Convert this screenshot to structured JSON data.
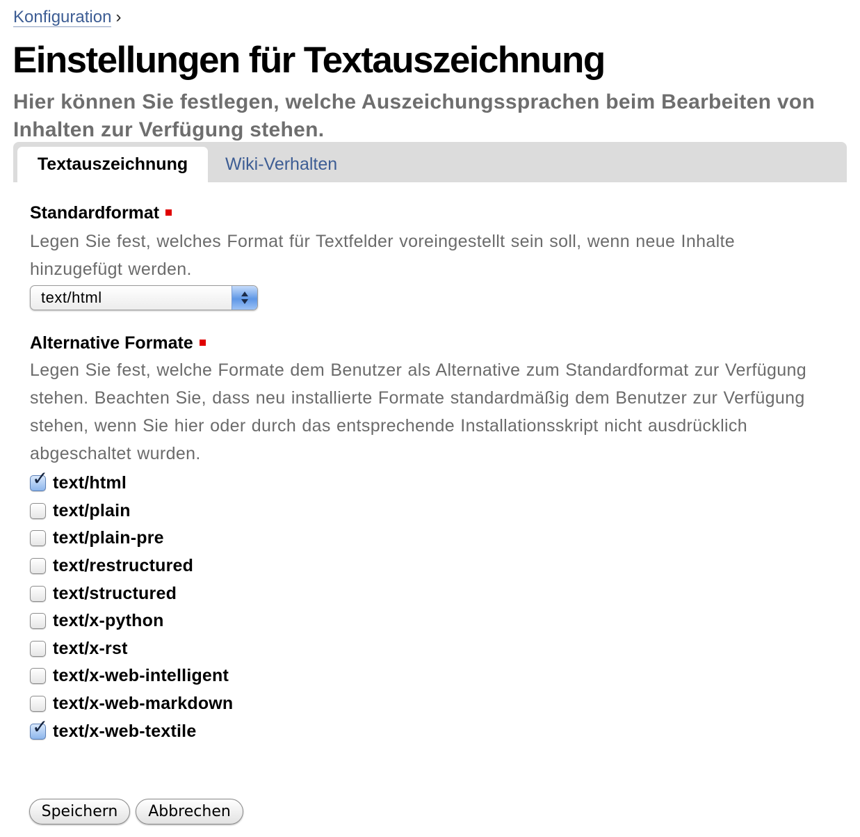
{
  "breadcrumb": {
    "link_label": "Konfiguration",
    "separator": "›"
  },
  "page": {
    "title": "Einstellungen für Textauszeichnung",
    "description": "Hier können Sie festlegen, welche Auszeichungssprachen beim Bearbeiten von Inhalten zur Verfügung stehen."
  },
  "tabs": [
    {
      "label": "Textauszeichnung",
      "active": true
    },
    {
      "label": "Wiki-Verhalten",
      "active": false
    }
  ],
  "default_format": {
    "label": "Standardformat",
    "help": "Legen Sie fest, welches Format für Textfelder voreingestellt sein soll, wenn neue Inhalte hinzugefügt werden.",
    "selected_value": "text/html"
  },
  "alternative_formats": {
    "label": "Alternative Formate",
    "help": "Legen Sie fest, welche Formate dem Benutzer als Alternative zum Standardformat zur Verfügung stehen. Beachten Sie, dass neu installierte Formate standardmäßig dem Benutzer zur Verfügung stehen, wenn Sie hier oder durch das entsprechende Installationsskript nicht ausdrücklich abgeschaltet wurden.",
    "options": [
      {
        "label": "text/html",
        "checked": true
      },
      {
        "label": "text/plain",
        "checked": false
      },
      {
        "label": "text/plain-pre",
        "checked": false
      },
      {
        "label": "text/restructured",
        "checked": false
      },
      {
        "label": "text/structured",
        "checked": false
      },
      {
        "label": "text/x-python",
        "checked": false
      },
      {
        "label": "text/x-rst",
        "checked": false
      },
      {
        "label": "text/x-web-intelligent",
        "checked": false
      },
      {
        "label": "text/x-web-markdown",
        "checked": false
      },
      {
        "label": "text/x-web-textile",
        "checked": true
      }
    ]
  },
  "buttons": {
    "save_label": "Speichern",
    "cancel_label": "Abbrechen"
  },
  "colors": {
    "link": "#3d5d94",
    "required_marker": "#e00000",
    "tab_bar": "#dcdcdc",
    "description_text": "#6e6e6e"
  }
}
